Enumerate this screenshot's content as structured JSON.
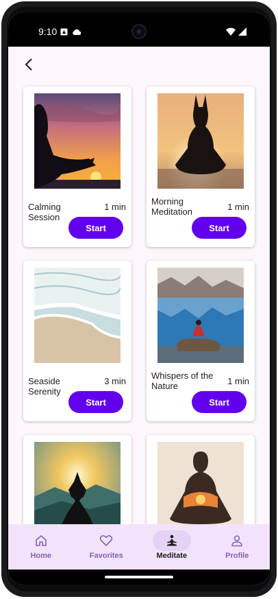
{
  "status_bar": {
    "time": "9:10",
    "left_icons": [
      "sim-card-icon",
      "cloud-icon"
    ],
    "right_icons": [
      "wifi-icon",
      "signal-icon"
    ]
  },
  "top_bar": {
    "back_icon": "back-arrow-icon"
  },
  "sessions": [
    {
      "title": "Calming Session",
      "duration": "1 min",
      "button": "Start",
      "image": "sunset-yoga-silhouette"
    },
    {
      "title": "Morning Meditation",
      "duration": "1 min",
      "button": "Start",
      "image": "sunrise-lake-meditation"
    },
    {
      "title": "Seaside Serenity",
      "duration": "3 min",
      "button": "Start",
      "image": "beach-waves"
    },
    {
      "title": "Whispers of the Nature",
      "duration": "1 min",
      "button": "Start",
      "image": "mountain-lake-meditation"
    },
    {
      "title": "",
      "duration": "",
      "button": "",
      "image": "mountain-sunrise-meditation"
    },
    {
      "title": "",
      "duration": "",
      "button": "",
      "image": "double-exposure-meditation"
    }
  ],
  "bottom_nav": {
    "items": [
      {
        "label": "Home",
        "icon": "home-icon",
        "active": false
      },
      {
        "label": "Favorites",
        "icon": "heart-icon",
        "active": false
      },
      {
        "label": "Meditate",
        "icon": "meditation-icon",
        "active": true
      },
      {
        "label": "Profile",
        "icon": "person-icon",
        "active": false
      }
    ]
  },
  "colors": {
    "accent": "#6200ee",
    "screen_background": "#fdf7fc",
    "nav_background": "#f1e4fa",
    "nav_indicator": "#e5d2f4",
    "nav_inactive_label": "#8a5db8"
  }
}
